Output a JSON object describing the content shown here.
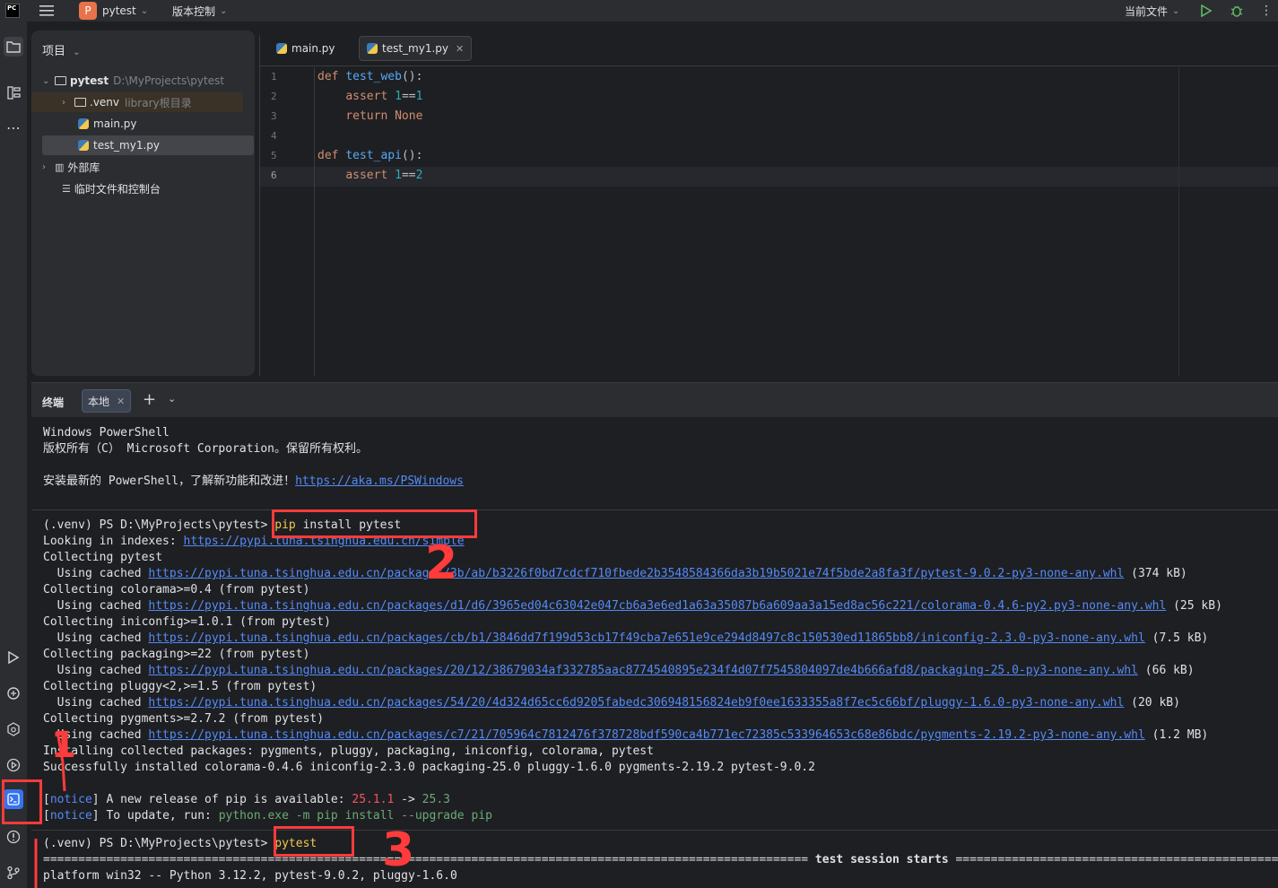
{
  "titlebar": {
    "project_initial": "P",
    "project_name": "pytest",
    "vcs_label": "版本控制",
    "current_file_label": "当前文件"
  },
  "project_panel": {
    "header": "项目",
    "tree": [
      {
        "name": "pytest",
        "hint": "D:\\MyProjects\\pytest"
      },
      {
        "name": ".venv",
        "hint": "library根目录"
      },
      {
        "name": "main.py",
        "hint": ""
      },
      {
        "name": "test_my1.py",
        "hint": ""
      },
      {
        "name": "外部库",
        "hint": ""
      },
      {
        "name": "临时文件和控制台",
        "hint": ""
      }
    ]
  },
  "editor": {
    "tabs": [
      {
        "label": "main.py"
      },
      {
        "label": "test_my1.py"
      }
    ],
    "line_numbers": [
      "1",
      "2",
      "3",
      "4",
      "5",
      "6"
    ]
  },
  "terminal": {
    "title": "终端",
    "tab_label": "本地",
    "lines": {
      "l1": "Windows PowerShell",
      "l2": "版权所有（C） Microsoft Corporation。保留所有权利。",
      "l3_pre": "安装最新的 PowerShell，了解新功能和改进！",
      "l3_link": "https://aka.ms/PSWindows",
      "prompt1": "(.venv) PS D:\\MyProjects\\pytest> ",
      "cmd1_a": "pip",
      "cmd1_b": " install pytest",
      "l5_pre": "Looking in indexes: ",
      "l5_link": "https://pypi.tuna.tsinghua.edu.cn/simple",
      "l6": "Collecting pytest",
      "l7_pre": "  Using cached ",
      "l7_link": "https://pypi.tuna.tsinghua.edu.cn/packages/3b/ab/b3226f0bd7cdcf710fbede2b3548584366da3b19b5021e74f5bde2a8fa3f/pytest-9.0.2-py3-none-any.whl",
      "l7_post": " (374 kB)",
      "l8": "Collecting colorama>=0.4 (from pytest)",
      "l9_pre": "  Using cached ",
      "l9_link": "https://pypi.tuna.tsinghua.edu.cn/packages/d1/d6/3965ed04c63042e047cb6a3e6ed1a63a35087b6a609aa3a15ed8ac56c221/colorama-0.4.6-py2.py3-none-any.whl",
      "l9_post": " (25 kB)",
      "l10": "Collecting iniconfig>=1.0.1 (from pytest)",
      "l11_pre": "  Using cached ",
      "l11_link": "https://pypi.tuna.tsinghua.edu.cn/packages/cb/b1/3846dd7f199d53cb17f49cba7e651e9ce294d8497c8c150530ed11865bb8/iniconfig-2.3.0-py3-none-any.whl",
      "l11_post": " (7.5 kB)",
      "l12": "Collecting packaging>=22 (from pytest)",
      "l13_pre": "  Using cached ",
      "l13_link": "https://pypi.tuna.tsinghua.edu.cn/packages/20/12/38679034af332785aac8774540895e234f4d07f7545804097de4b666afd8/packaging-25.0-py3-none-any.whl",
      "l13_post": " (66 kB)",
      "l14": "Collecting pluggy<2,>=1.5 (from pytest)",
      "l15_pre": "  Using cached ",
      "l15_link": "https://pypi.tuna.tsinghua.edu.cn/packages/54/20/4d324d65cc6d9205fabedc306948156824eb9f0ee1633355a8f7ec5c66bf/pluggy-1.6.0-py3-none-any.whl",
      "l15_post": " (20 kB)",
      "l16": "Collecting pygments>=2.7.2 (from pytest)",
      "l17_pre": "  Using cached ",
      "l17_link": "https://pypi.tuna.tsinghua.edu.cn/packages/c7/21/705964c7812476f378728bdf590ca4b771ec72385c533964653c68e86bdc/pygments-2.19.2-py3-none-any.whl",
      "l17_post": " (1.2 MB)",
      "l18": "Installing collected packages: pygments, pluggy, packaging, iniconfig, colorama, pytest",
      "l19": "Successfully installed colorama-0.4.6 iniconfig-2.3.0 packaging-25.0 pluggy-1.6.0 pygments-2.19.2 pytest-9.0.2",
      "n1_tag": "notice",
      "n1_text": " A new release of pip is available: ",
      "n1_old": "25.1.1",
      "n1_arrow": " -> ",
      "n1_new": "25.3",
      "n2_tag": "notice",
      "n2_text": " To update, run: ",
      "n2_cmd": "python.exe -m pip install --upgrade pip",
      "prompt2": "(.venv) PS D:\\MyProjects\\pytest> ",
      "cmd2": "pytest",
      "session_left": "=============================================================================================================",
      "session_mid": " test session starts ",
      "session_right": "==================================================",
      "platform": "platform win32 -- Python 3.12.2, pytest-9.0.2, pluggy-1.6.0"
    }
  },
  "annotations": [
    "1",
    "2",
    "3"
  ],
  "colors": {
    "accent": "#3574f0",
    "annotation": "#ff3b3b",
    "link": "#548af7"
  }
}
